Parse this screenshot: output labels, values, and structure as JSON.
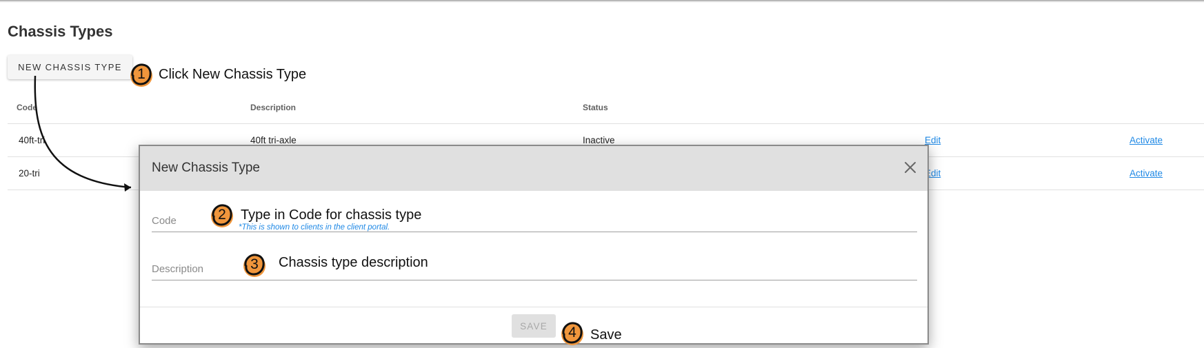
{
  "page": {
    "title": "Chassis Types",
    "new_button_label": "NEW CHASSIS TYPE"
  },
  "table": {
    "headers": {
      "code": "Code",
      "description": "Description",
      "status": "Status"
    },
    "rows": [
      {
        "code": "40ft-tri",
        "description": "40ft tri-axle",
        "status": "Inactive",
        "edit_label": "Edit",
        "action_label": "Activate"
      },
      {
        "code": "20-tri",
        "description": "",
        "status": "",
        "edit_label": "Edit",
        "action_label": "Activate"
      }
    ]
  },
  "modal": {
    "title": "New Chassis Type",
    "close_icon": "close-icon",
    "fields": {
      "code": {
        "label": "Code",
        "value": "",
        "helper": "*This is shown to clients in the client portal."
      },
      "description": {
        "label": "Description",
        "value": ""
      }
    },
    "save_label": "SAVE"
  },
  "annotations": [
    {
      "number": "1",
      "text": "Click New Chassis Type"
    },
    {
      "number": "2",
      "text": "Type in Code for chassis type"
    },
    {
      "number": "3",
      "text": "Chassis type description"
    },
    {
      "number": "4",
      "text": "Save"
    }
  ],
  "colors": {
    "accent_link": "#1e88e5",
    "callout_fill": "#f0963c",
    "modal_header": "#e0e0e0"
  }
}
